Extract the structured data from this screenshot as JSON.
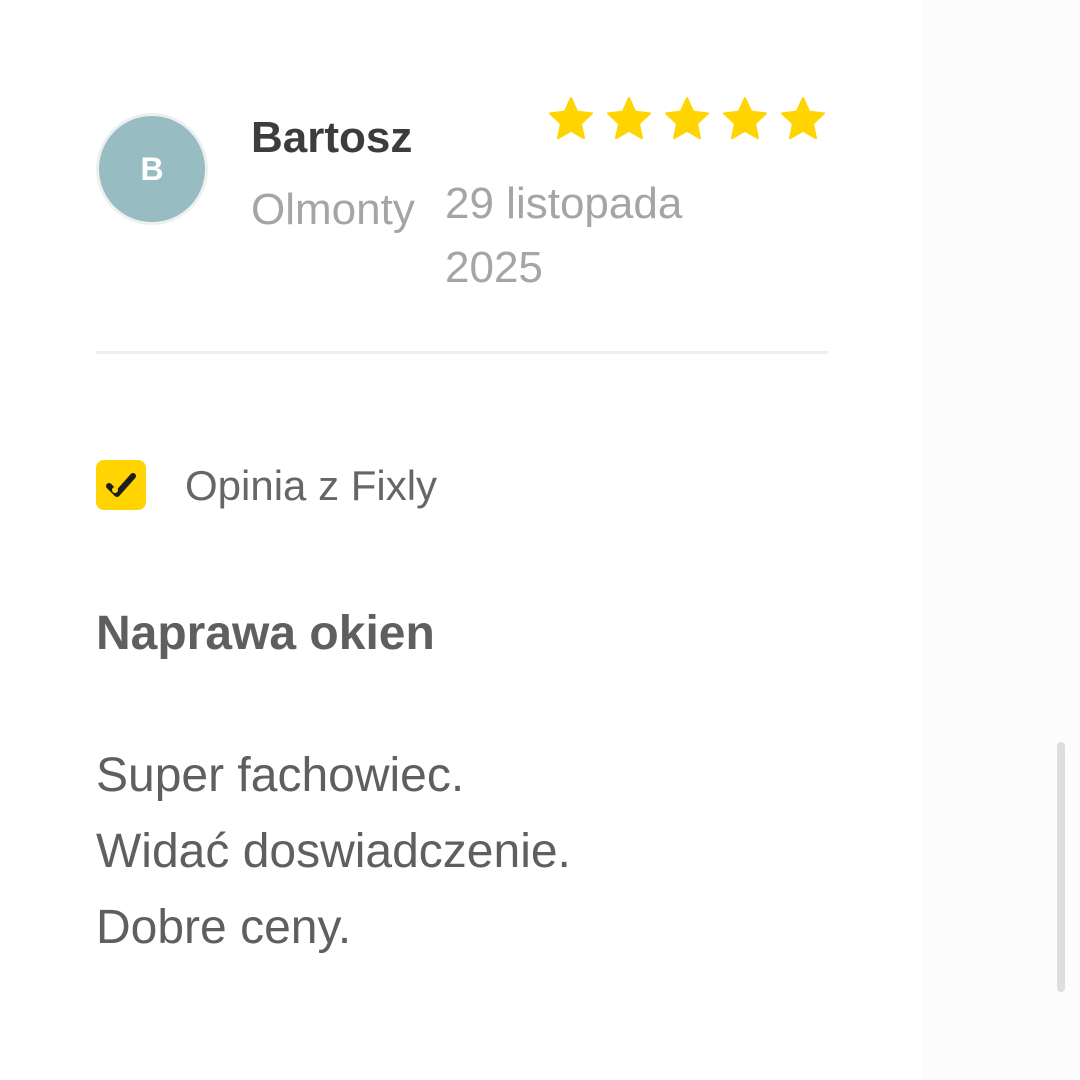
{
  "review": {
    "avatar_initial": "B",
    "reviewer_name": "Bartosz",
    "reviewer_city": "Olmonty",
    "date": "29 listopada 2025",
    "rating": 5,
    "rating_max": 5,
    "source_label": "Opinia z Fixly",
    "title": "Naprawa okien",
    "body_lines": [
      "Super fachowiec.",
      "Widać doswiadczenie.",
      "Dobre ceny."
    ]
  },
  "icons": {
    "star": "star-icon",
    "source": "checkmark-icon"
  },
  "colors": {
    "star": "#ffd400",
    "badge": "#ffd400",
    "avatar": "#97bcc2",
    "name": "#3c3c3c",
    "muted": "#a5a5a5",
    "text": "#5f5f5f"
  }
}
